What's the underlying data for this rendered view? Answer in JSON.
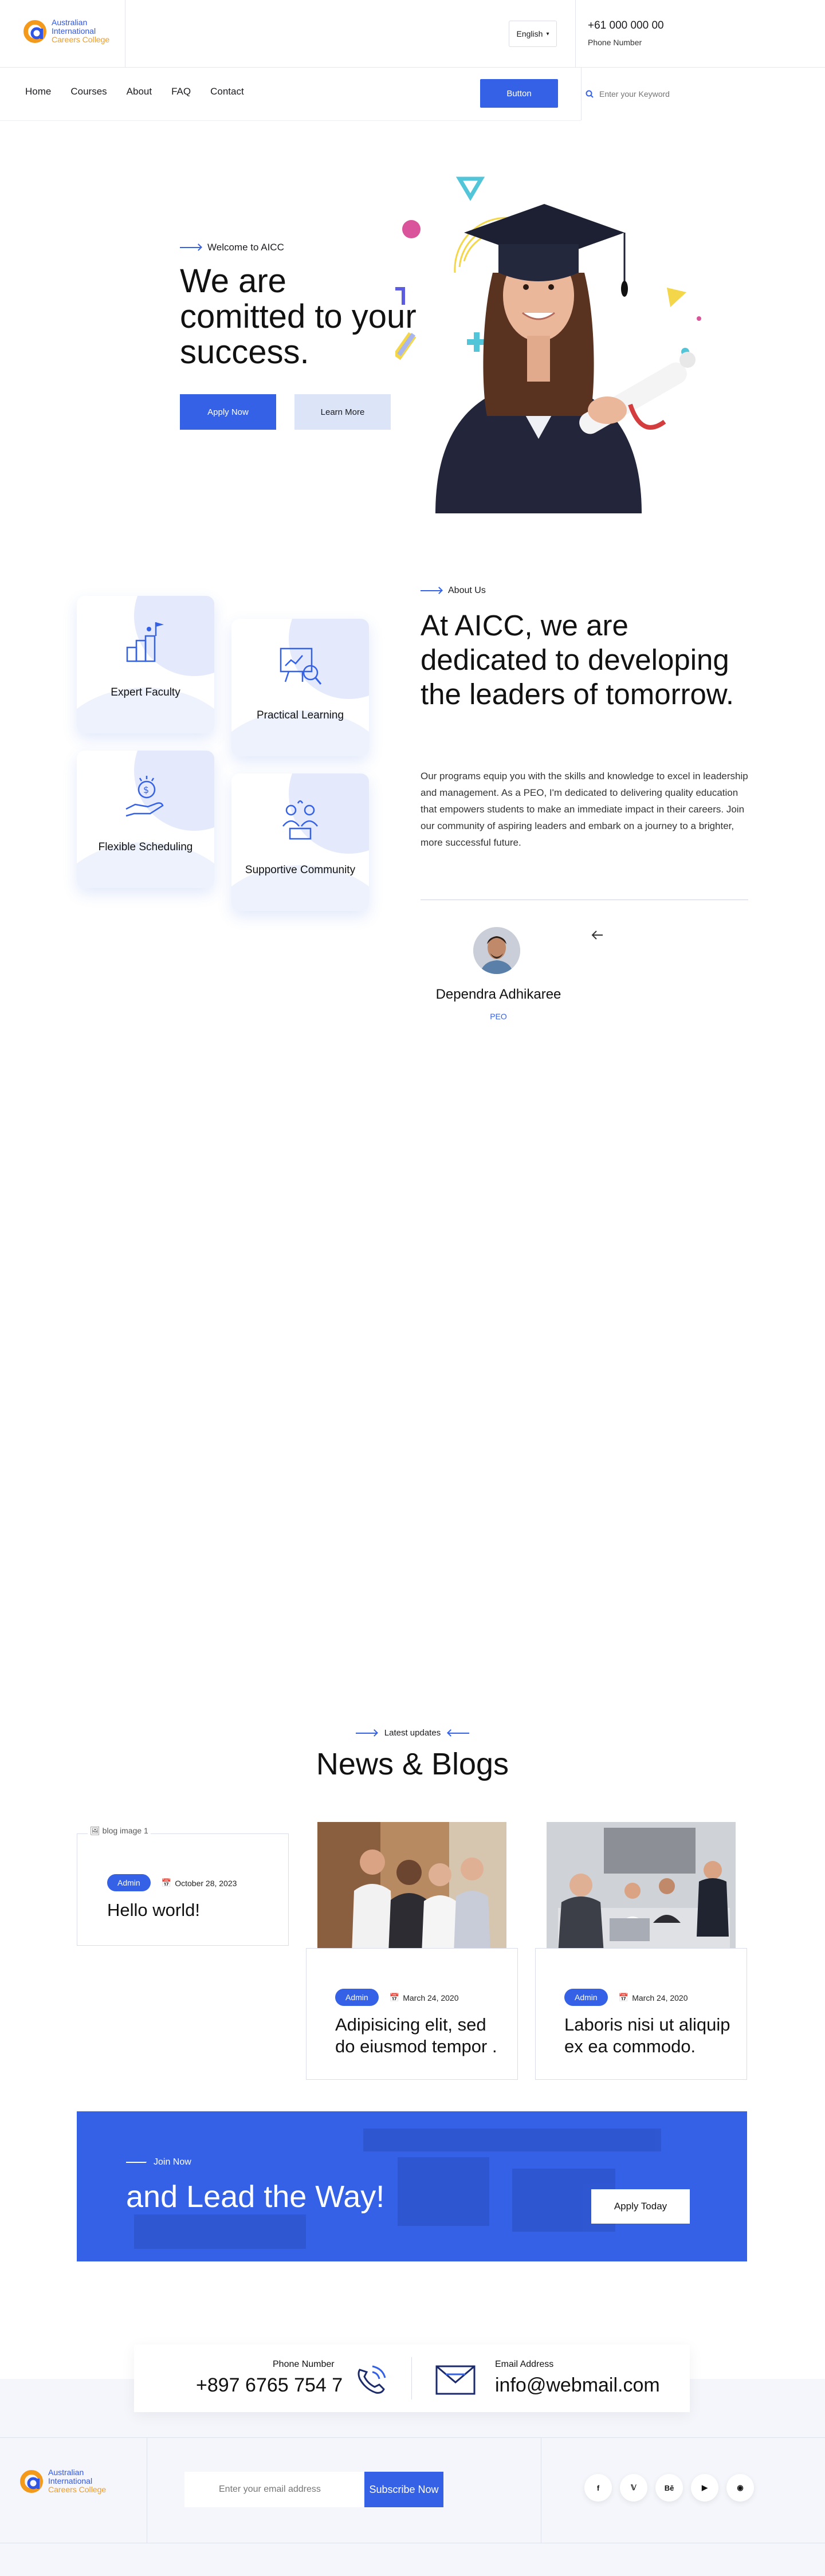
{
  "brand": {
    "line1": "Australian",
    "line2": "International",
    "line3": "Careers College",
    "blue": "#2f55e4",
    "orange": "#f39a1c"
  },
  "topbar": {
    "language": "English",
    "phone": "+61 000 000 00",
    "phone_label": "Phone Number"
  },
  "nav": {
    "items": [
      "Home",
      "Courses",
      "About",
      "FAQ",
      "Contact"
    ],
    "button": "Button",
    "search_placeholder": "Enter your Keyword"
  },
  "hero": {
    "eyebrow": "Welcome to AICC",
    "title": "We are comitted to your success.",
    "apply_button": "Apply Now",
    "learn_button": "Learn More"
  },
  "features": [
    {
      "label": "Expert Faculty",
      "icon": "podium-flag-icon"
    },
    {
      "label": "Practical Learning",
      "icon": "presentation-board-icon"
    },
    {
      "label": "Flexible Scheduling",
      "icon": "hand-coin-icon"
    },
    {
      "label": "Supportive Community",
      "icon": "community-people-icon"
    }
  ],
  "about": {
    "eyebrow": "About Us",
    "title": "At AICC, we are dedicated to developing the leaders of tomorrow.",
    "text": "Our programs equip you with the skills and knowledge to excel in leadership and management. As a PEO, I'm dedicated to delivering quality education that empowers students to make an immediate impact in their careers. Join our community of aspiring leaders and embark on a journey to a brighter, more successful future.",
    "person_name": "Dependra Adhikaree",
    "person_role": "PEO"
  },
  "blogs": {
    "eyebrow": "Latest updates",
    "title": "News & Blogs",
    "posts": [
      {
        "badge": "Admin",
        "date": "October 28, 2023",
        "title": "Hello world!",
        "image_alt": "blog image 1"
      },
      {
        "badge": "Admin",
        "date": "March 24, 2020",
        "title": "Adipisicing elit, sed do eiusmod tempor ."
      },
      {
        "badge": "Admin",
        "date": "March 24, 2020",
        "title": "Laboris nisi ut aliquip ex ea commodo."
      }
    ]
  },
  "cta": {
    "eyebrow": "Join Now",
    "title": "and Lead the Way!",
    "button": "Apply Today"
  },
  "contact": {
    "phone_label": "Phone Number",
    "phone": "+897 6765 754 7",
    "email_label": "Email Address",
    "email": "info@webmail.com"
  },
  "footer": {
    "newsletter_placeholder": "Enter your email address",
    "subscribe": "Subscribe Now",
    "social": [
      "facebook-icon",
      "twitter-icon",
      "behance-icon",
      "youtube-icon",
      "instagram-icon"
    ]
  },
  "colors": {
    "accent": "#3561e6",
    "accent_light": "#dbe5f7"
  }
}
